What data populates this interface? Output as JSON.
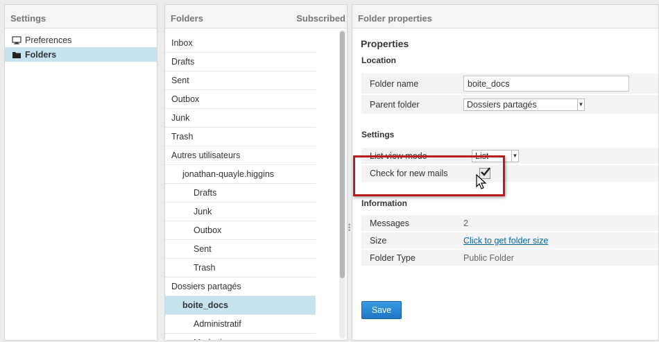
{
  "settings": {
    "title": "Settings",
    "items": [
      {
        "label": "Preferences",
        "icon": "monitor-icon",
        "selected": false
      },
      {
        "label": "Folders",
        "icon": "folder-icon",
        "selected": true
      }
    ]
  },
  "folders": {
    "title": "Folders",
    "subscribed_label": "Subscribed",
    "rows": [
      {
        "label": "Inbox",
        "level": 0
      },
      {
        "label": "Drafts",
        "level": 0
      },
      {
        "label": "Sent",
        "level": 0
      },
      {
        "label": "Outbox",
        "level": 0
      },
      {
        "label": "Junk",
        "level": 0
      },
      {
        "label": "Trash",
        "level": 0
      },
      {
        "label": "Autres utilisateurs",
        "level": 0
      },
      {
        "label": "jonathan-quayle.higgins",
        "level": 1
      },
      {
        "label": "Drafts",
        "level": 2
      },
      {
        "label": "Junk",
        "level": 2
      },
      {
        "label": "Outbox",
        "level": 2
      },
      {
        "label": "Sent",
        "level": 2
      },
      {
        "label": "Trash",
        "level": 2
      },
      {
        "label": "Dossiers partagés",
        "level": 0
      },
      {
        "label": "boite_docs",
        "level": 1,
        "selected": true
      },
      {
        "label": "Administratif",
        "level": 2
      },
      {
        "label": "Marketing",
        "level": 2
      }
    ]
  },
  "props": {
    "title": "Folder properties",
    "heading": "Properties",
    "location_title": "Location",
    "folder_name_label": "Folder name",
    "folder_name_value": "boite_docs",
    "parent_folder_label": "Parent folder",
    "parent_folder_value": "Dossiers partagés",
    "settings_title": "Settings",
    "list_view_label": "List view mode",
    "list_view_value": "List",
    "check_mail_label": "Check for new mails",
    "check_mail_checked": true,
    "info_title": "Information",
    "messages_label": "Messages",
    "messages_value": "2",
    "size_label": "Size",
    "size_link": "Click to get folder size",
    "type_label": "Folder Type",
    "type_value": "Public Folder",
    "save_label": "Save"
  },
  "colors": {
    "selected_row": "#c7e3ef",
    "save_button": "#2f8cd8",
    "highlight": "#b81c1c",
    "link": "#0069a6"
  }
}
